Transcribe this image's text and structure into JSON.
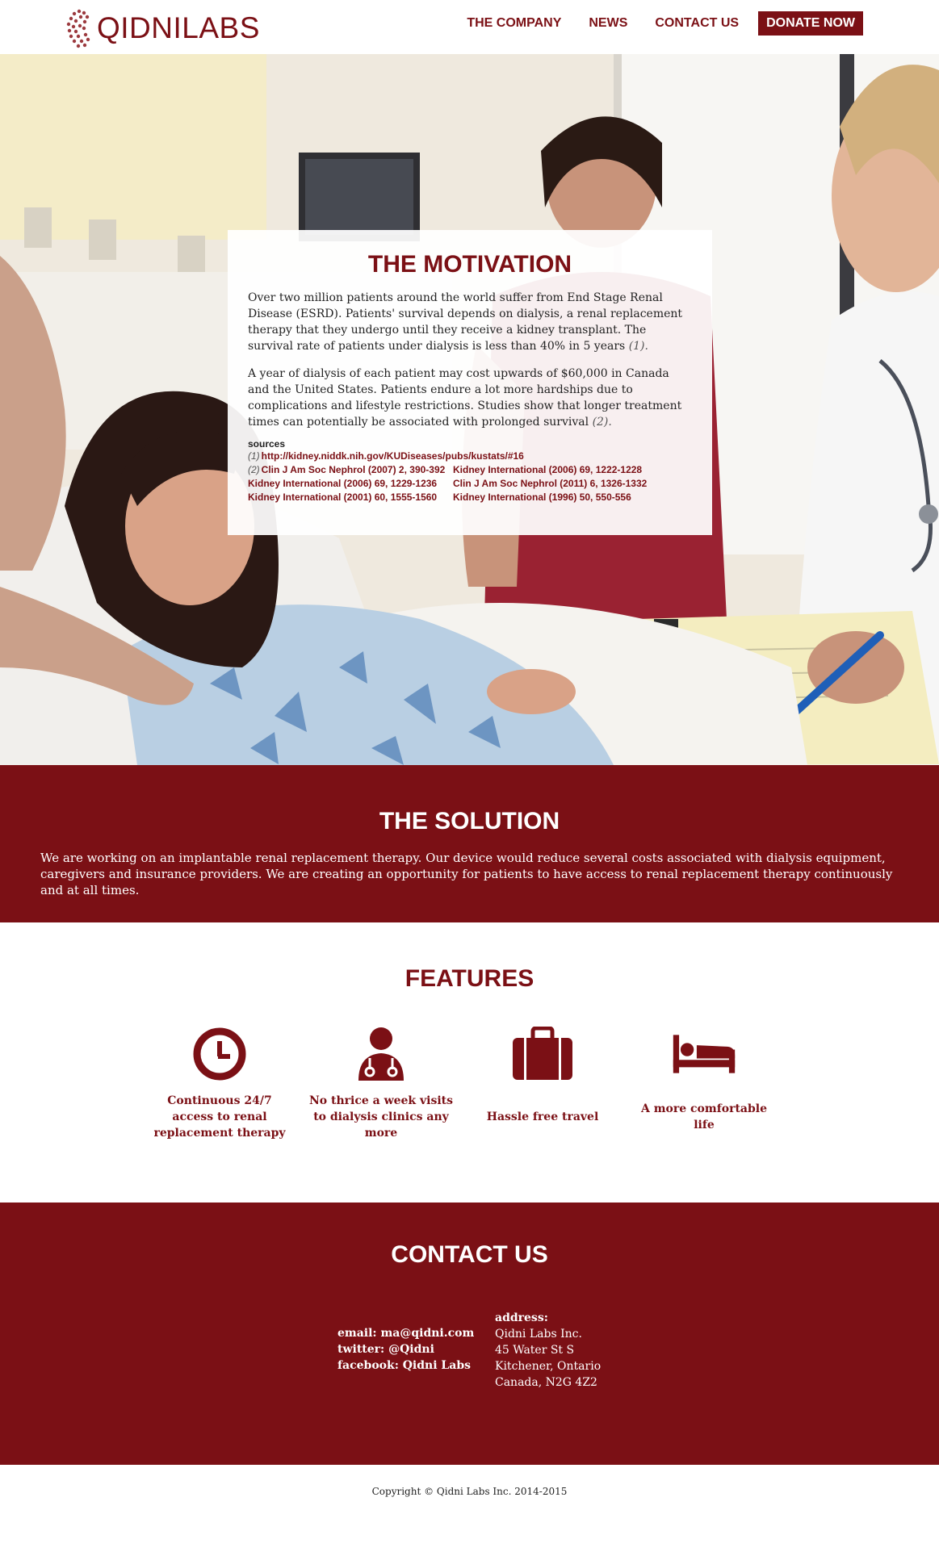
{
  "brand": {
    "name_bold": "QIDNI",
    "name_thin": "LABS",
    "color": "#7b1015"
  },
  "nav": {
    "items": [
      {
        "label": "THE COMPANY"
      },
      {
        "label": "NEWS"
      },
      {
        "label": "CONTACT US"
      }
    ],
    "donate": "DONATE NOW"
  },
  "motivation": {
    "title": "THE MOTIVATION",
    "p1_text": "Over two million patients around the world suffer from End Stage Renal Disease (ESRD). Patients' survival depends on dialysis, a renal replacement therapy that they undergo until they receive a kidney transplant. The survival rate of patients under dialysis is less than 40% in 5 years",
    "p1_ref": "(1).",
    "p2_text": "A year of dialysis of each patient may cost upwards of $60,000 in Canada and the United States. Patients endure a lot more hardships due to complications and lifestyle restrictions. Studies show that longer treatment times can potentially be associated with prolonged survival",
    "p2_ref": "(2).",
    "sources_heading": "sources",
    "source1_num": "(1)",
    "source1": "http://kidney.niddk.nih.gov/KUDiseases/pubs/kustats/#16",
    "source2_num": "(2)",
    "source2a": "Clin J Am Soc Nephrol (2007) 2, 390-392",
    "source2b": "Kidney International (2006) 69, 1222-1228",
    "source3a": "Kidney International (2006) 69, 1229-1236",
    "source3b": "Clin J Am Soc Nephrol (2011) 6, 1326-1332",
    "source4a": "Kidney International (2001) 60, 1555-1560",
    "source4b": "Kidney International (1996) 50, 550-556"
  },
  "solution": {
    "title": "THE SOLUTION",
    "text": "We are working on an implantable renal replacement therapy. Our device would reduce several costs associated with dialysis equipment, caregivers and insurance providers. We are creating an opportunity for patients to have access to renal replacement therapy continuously and at all times."
  },
  "features": {
    "title": "FEATURES",
    "items": [
      {
        "icon": "clock-icon",
        "label": "Continuous 24/7 access to renal replacement therapy"
      },
      {
        "icon": "doctor-icon",
        "label": "No thrice a week visits to dialysis clinics any more"
      },
      {
        "icon": "suitcase-icon",
        "label": "Hassle free travel"
      },
      {
        "icon": "bed-icon",
        "label": "A more comfortable life"
      }
    ]
  },
  "contact": {
    "title": "CONTACT US",
    "email": "email: ma@qidni.com",
    "twitter": "twitter: @Qidni",
    "facebook": "facebook: Qidni Labs",
    "address_label": "address:",
    "address_line1": "Qidni Labs Inc.",
    "address_line2": "45 Water St S",
    "address_line3": "Kitchener, Ontario",
    "address_line4": "Canada, N2G 4Z2"
  },
  "footer": {
    "copyright": "Copyright © Qidni Labs Inc. 2014-2015"
  }
}
